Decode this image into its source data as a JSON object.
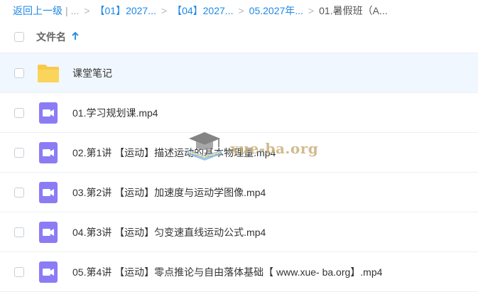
{
  "breadcrumb": {
    "back": "返回上一级",
    "pipe": "|",
    "dots": "...",
    "items": [
      "【01】2027...",
      "【04】2027...",
      "05.2027年...",
      "01.暑假班（A..."
    ]
  },
  "header": {
    "column_name": "文件名",
    "sort_icon": "arrow-up-icon"
  },
  "files": [
    {
      "name": "课堂笔记",
      "type": "folder"
    },
    {
      "name": "01.学习规划课.mp4",
      "type": "video"
    },
    {
      "name": "02.第1讲 【运动】描述运动的基本物理量.mp4",
      "type": "video"
    },
    {
      "name": "03.第2讲 【运动】加速度与运动学图像.mp4",
      "type": "video"
    },
    {
      "name": "04.第3讲 【运动】匀变速直线运动公式.mp4",
      "type": "video"
    },
    {
      "name": "05.第4讲 【运动】零点推论与自由落体基础【 www.xue- ba.org】.mp4",
      "type": "video"
    }
  ],
  "watermark": {
    "text": "xue-ba.org",
    "icon": "graduation-cap-book-icon"
  },
  "colors": {
    "accent": "#1e88e5",
    "folder": "#f8c94a",
    "video": "#8b7cf6",
    "selected_row": "#f1f7fe"
  }
}
